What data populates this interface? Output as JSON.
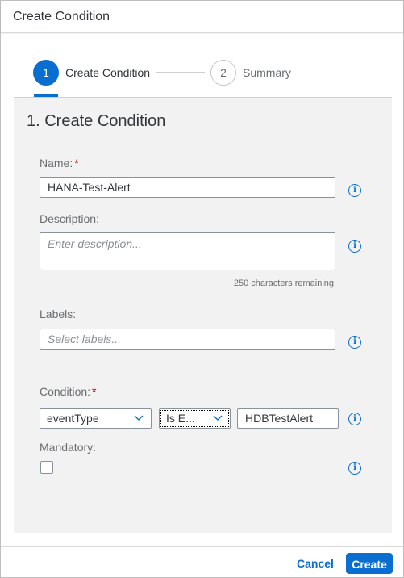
{
  "dialog": {
    "title": "Create Condition"
  },
  "stepper": {
    "steps": [
      {
        "number": "1",
        "label": "Create Condition",
        "active": true
      },
      {
        "number": "2",
        "label": "Summary",
        "active": false
      }
    ]
  },
  "form": {
    "section_title": "1. Create Condition",
    "name": {
      "label": "Name:",
      "required_mark": "*",
      "value": "HANA-Test-Alert"
    },
    "description": {
      "label": "Description:",
      "placeholder": "Enter description...",
      "value": "",
      "remaining": "250 characters remaining"
    },
    "labels": {
      "label": "Labels:",
      "placeholder": "Select labels..."
    },
    "condition": {
      "label": "Condition:",
      "required_mark": "*",
      "field": "eventType",
      "operator": "Is E...",
      "value": "HDBTestAlert"
    },
    "mandatory": {
      "label": "Mandatory:",
      "checked": false
    },
    "info_icon": "i"
  },
  "footer": {
    "cancel_label": "Cancel",
    "create_label": "Create"
  },
  "colors": {
    "accent": "#0a6ed1",
    "required": "#bb0000",
    "content_bg": "#f2f2f2"
  }
}
